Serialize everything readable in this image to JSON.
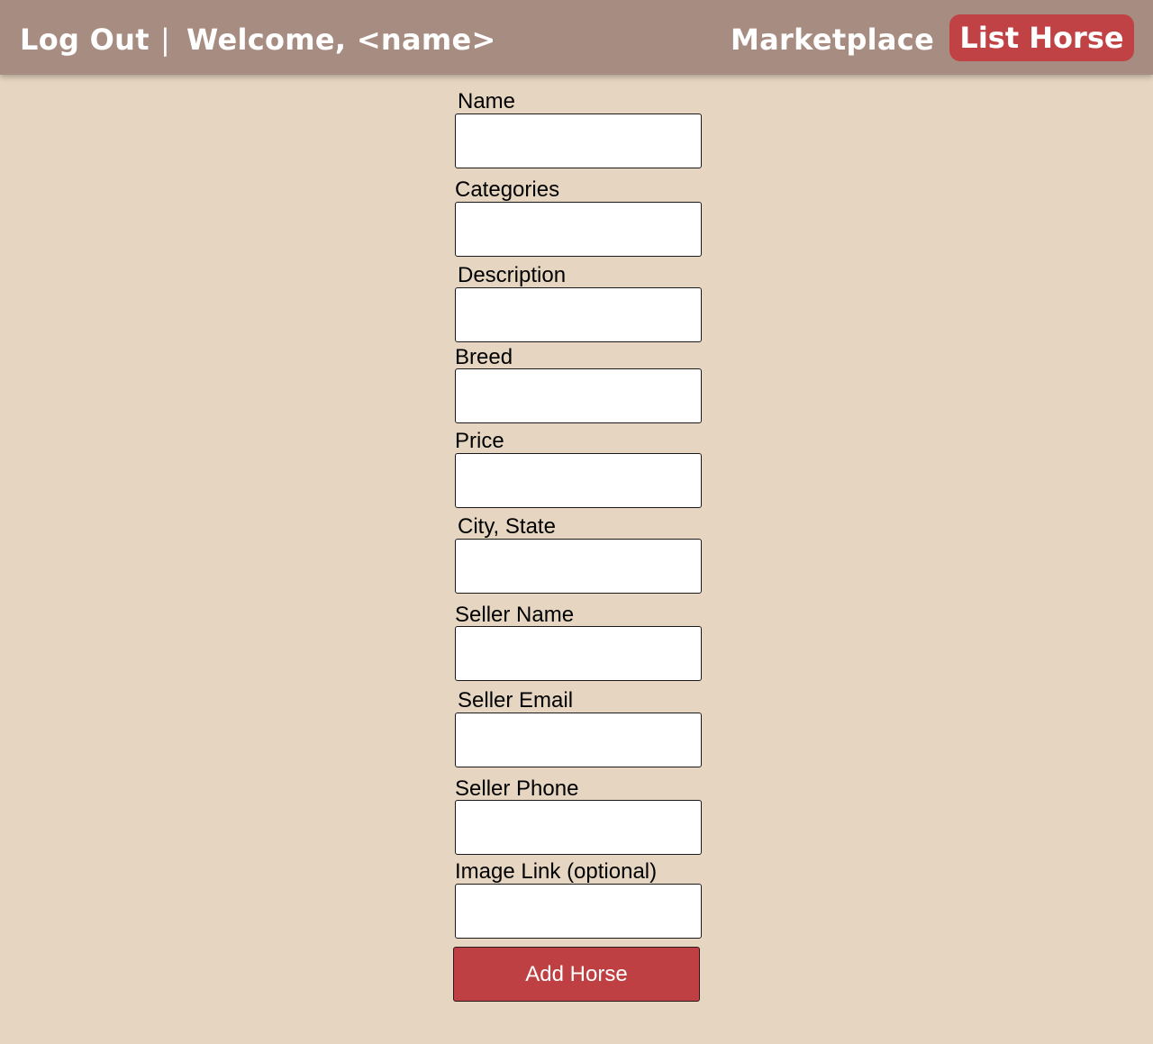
{
  "header": {
    "logout_label": "Log Out",
    "separator": "|",
    "welcome_text": "Welcome, <name>",
    "marketplace_label": "Marketplace",
    "list_horse_label": "List Horse"
  },
  "colors": {
    "page_background": "#e6d6c1",
    "header_background": "#a78c81",
    "accent": "#c14244"
  },
  "form": {
    "fields": [
      {
        "label": "Name",
        "value": "",
        "placeholder": ""
      },
      {
        "label": "Categories",
        "value": "",
        "placeholder": ""
      },
      {
        "label": "Description",
        "value": "",
        "placeholder": ""
      },
      {
        "label": "Breed",
        "value": "",
        "placeholder": ""
      },
      {
        "label": "Price",
        "value": "",
        "placeholder": ""
      },
      {
        "label": "City, State",
        "value": "",
        "placeholder": ""
      },
      {
        "label": "Seller Name",
        "value": "",
        "placeholder": ""
      },
      {
        "label": "Seller Email",
        "value": "",
        "placeholder": ""
      },
      {
        "label": "Seller Phone",
        "value": "",
        "placeholder": ""
      },
      {
        "label": "Image Link (optional)",
        "value": "",
        "placeholder": ""
      }
    ],
    "submit_label": "Add Horse"
  }
}
